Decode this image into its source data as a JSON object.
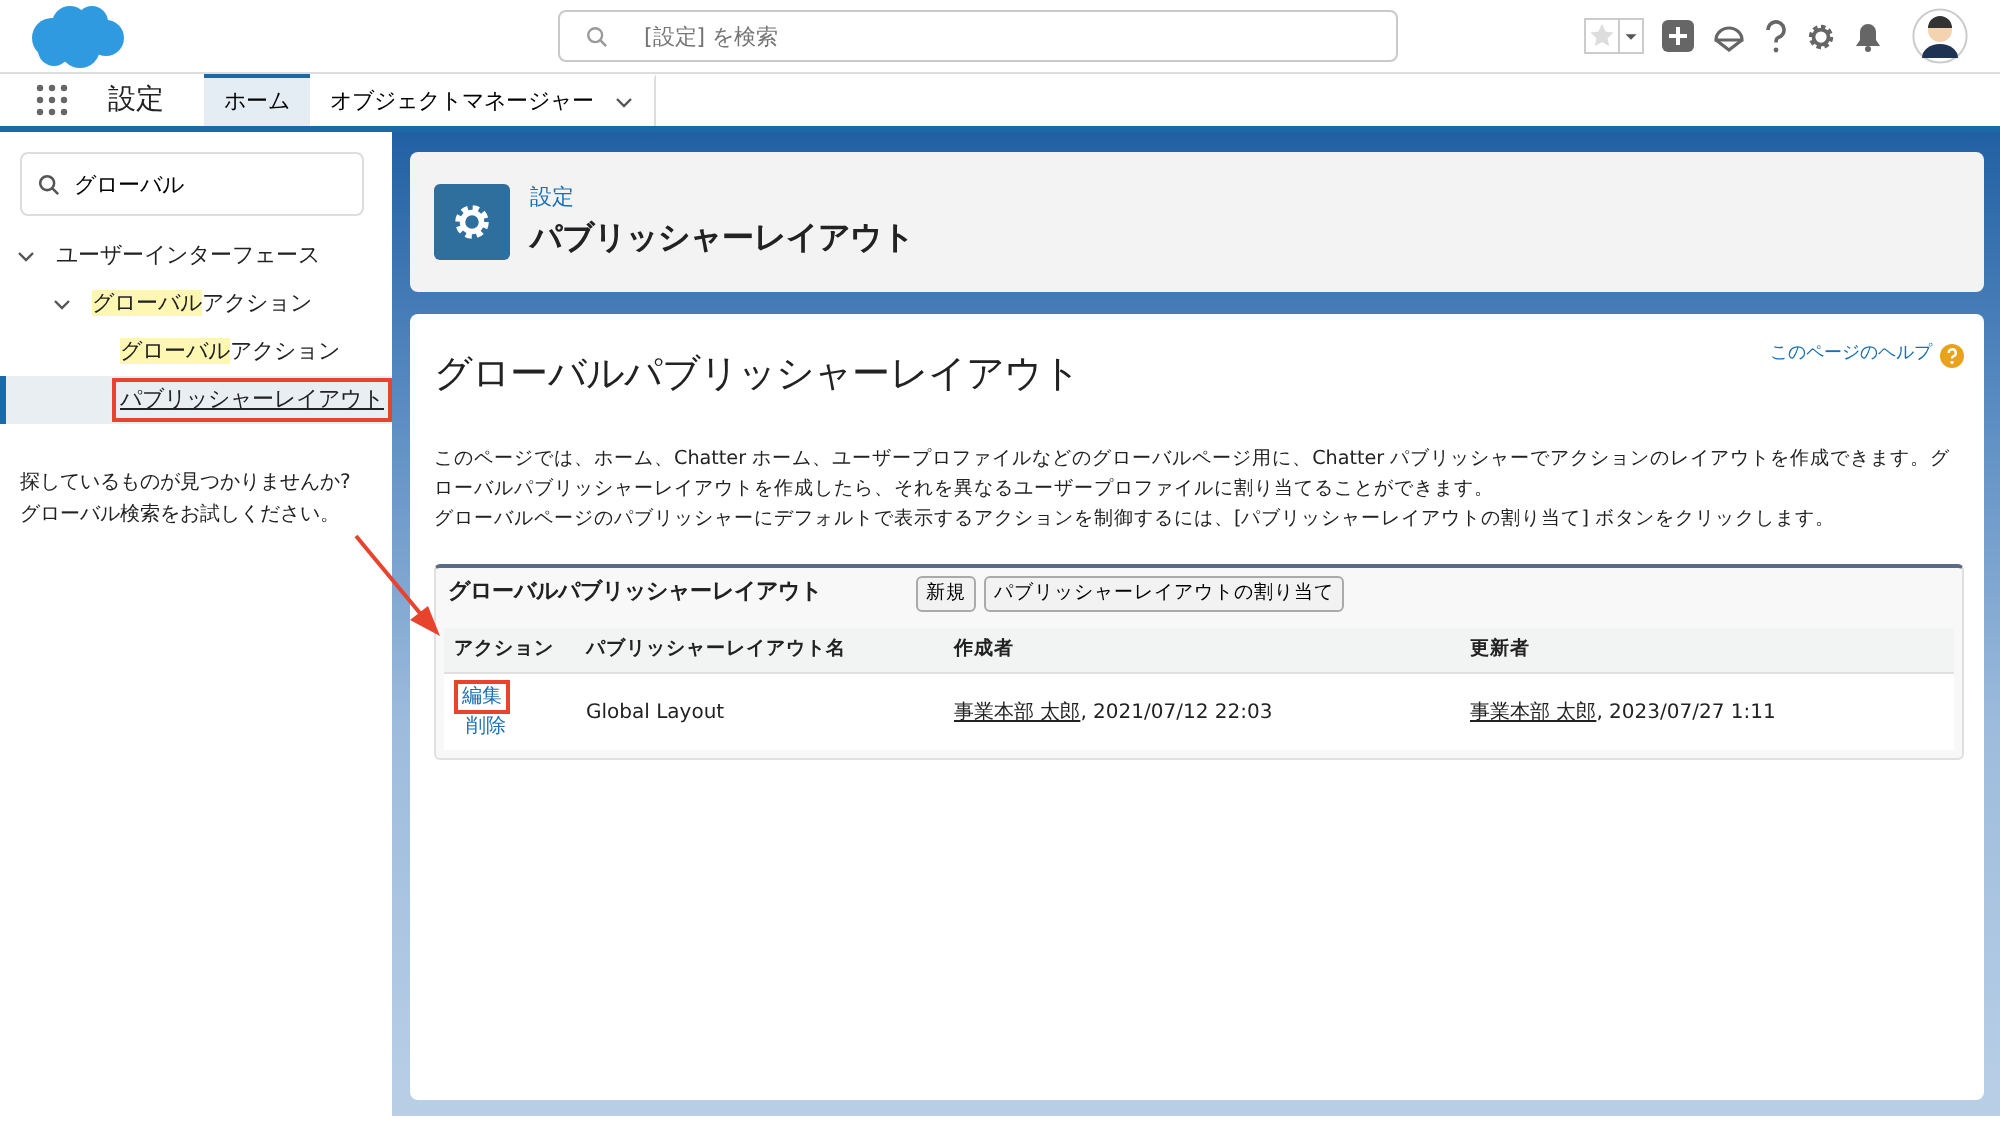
{
  "header": {
    "search": {
      "placeholder": "[設定] を検索"
    }
  },
  "nav": {
    "app_name": "設定",
    "tabs": [
      {
        "label": "ホーム",
        "selected": true,
        "dropdown": false
      },
      {
        "label": "オブジェクトマネージャー",
        "selected": false,
        "dropdown": true
      }
    ]
  },
  "sidebar": {
    "search": {
      "value": "グローバル"
    },
    "tree": [
      {
        "parts": [
          {
            "text": "ユーザーインターフェース",
            "highlighted": false
          }
        ],
        "expanded": true,
        "selected": false,
        "annotated": false,
        "children": [
          {
            "parts": [
              {
                "text": "グローバル",
                "highlighted": true
              },
              {
                "text": "アクション",
                "highlighted": false
              }
            ],
            "expanded": true,
            "selected": false,
            "annotated": false,
            "children": [
              {
                "parts": [
                  {
                    "text": "グローバル",
                    "highlighted": true
                  },
                  {
                    "text": "アクション",
                    "highlighted": false
                  }
                ],
                "selected": false,
                "annotated": false
              },
              {
                "parts": [
                  {
                    "text": "パブリッシャーレイアウト",
                    "highlighted": false
                  }
                ],
                "selected": true,
                "annotated": true
              }
            ]
          }
        ]
      }
    ],
    "not_found": [
      "探しているものが見つかりませんか?",
      "グローバル検索をお試しください。"
    ]
  },
  "page_header": {
    "breadcrumb": "設定",
    "title": "パブリッシャーレイアウト"
  },
  "content": {
    "title": "グローバルパブリッシャーレイアウト",
    "help_link": "このページのヘルプ",
    "description": [
      "このページでは、ホーム、Chatter ホーム、ユーザープロファイルなどのグローバルページ用に、Chatter パブリッシャーでアクションのレイアウトを作成できます。グローバルパブリッシャーレイアウトを作成したら、それを異なるユーザープロファイルに割り当てることができます。",
      "グローバルページのパブリッシャーにデフォルトで表示するアクションを制御するには、[パブリッシャーレイアウトの割り当て] ボタンをクリックします。"
    ],
    "section": {
      "title": "グローバルパブリッシャーレイアウト",
      "buttons": [
        "新規",
        "パブリッシャーレイアウトの割り当て"
      ],
      "table": {
        "columns": [
          "アクション",
          "パブリッシャーレイアウト名",
          "作成者",
          "更新者"
        ],
        "rows": [
          {
            "actions": [
              {
                "label": "編集",
                "annotated": true
              },
              {
                "label": "削除",
                "annotated": false
              }
            ],
            "name": "Global Layout",
            "created_by": {
              "user": "事業本部 太郎",
              "date": ", 2021/07/12 22:03"
            },
            "modified_by": {
              "user": "事業本部 太郎",
              "date": ", 2023/07/27 1:11"
            }
          }
        ]
      }
    }
  }
}
